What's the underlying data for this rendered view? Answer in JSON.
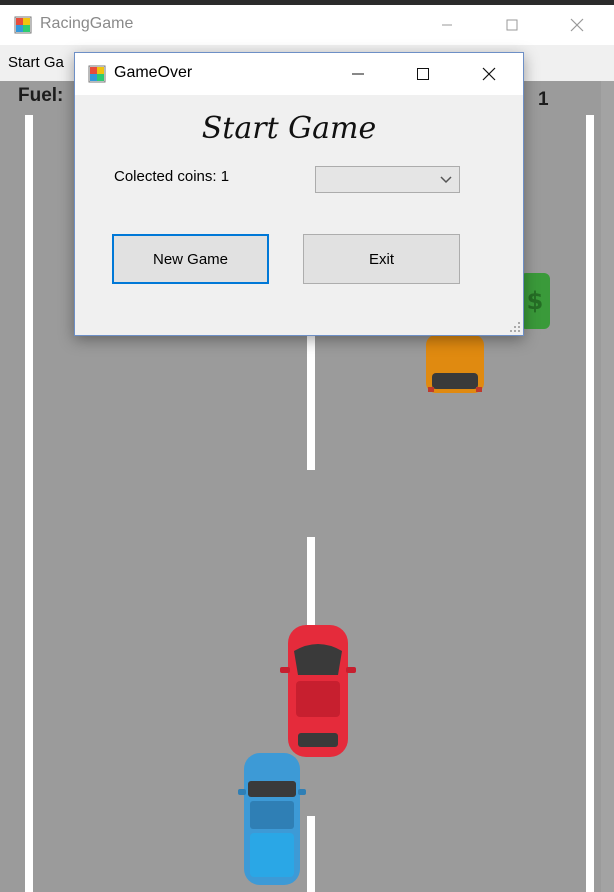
{
  "main_window": {
    "title": "RacingGame",
    "menu": [
      "Start Ga"
    ],
    "controls": [
      "minimize-icon",
      "maximize-icon",
      "close-icon"
    ]
  },
  "hud": {
    "fuel_label": "Fuel:",
    "coins_value": "1"
  },
  "dialog": {
    "title": "GameOver",
    "heading": "Start Game",
    "coins_label": "Colected coins: 1",
    "combo_value": "",
    "new_game_label": "New Game",
    "exit_label": "Exit",
    "controls": [
      "minimize-icon",
      "maximize-icon",
      "close-icon"
    ]
  },
  "colors": {
    "road": "#9b9b9b",
    "lane_line": "#ffffff",
    "player_car": "#3d9ad6",
    "red_car": "#e52b3b",
    "orange_car": "#e08a10",
    "coin": "#3a9a3a",
    "focus_border": "#0078d7"
  }
}
